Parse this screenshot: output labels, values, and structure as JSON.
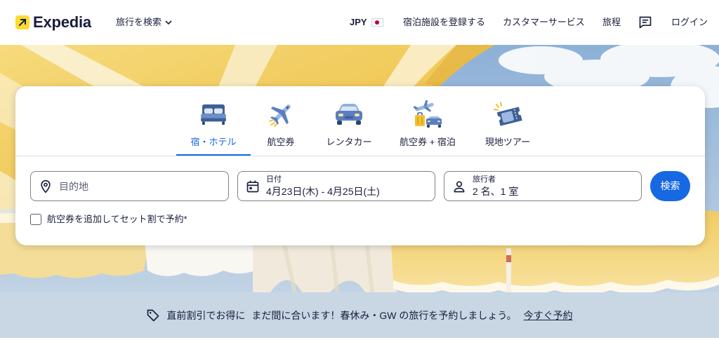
{
  "header": {
    "logo_text": "Expedia",
    "logo_icon": "expedia-arrow-icon",
    "search_menu_label": "旅行を検索",
    "currency": "JPY",
    "currency_flag": "japan-flag-icon",
    "list_property_label": "宿泊施設を登録する",
    "support_label": "カスタマーサービス",
    "trips_label": "旅程",
    "inbox_icon": "chat-icon",
    "login_label": "ログイン"
  },
  "search": {
    "tabs": [
      {
        "label": "宿・ホテル",
        "icon": "bed-icon",
        "active": true
      },
      {
        "label": "航空券",
        "icon": "plane-icon",
        "active": false
      },
      {
        "label": "レンタカー",
        "icon": "car-icon",
        "active": false
      },
      {
        "label": "航空券 + 宿泊",
        "icon": "plane-luggage-car-icon",
        "active": false
      },
      {
        "label": "現地ツアー",
        "icon": "ticket-icon",
        "active": false
      }
    ],
    "destination": {
      "placeholder": "目的地",
      "icon": "map-pin-icon"
    },
    "dates": {
      "label": "日付",
      "value": "4月23日(木) - 4月25日(土)",
      "icon": "calendar-icon"
    },
    "travelers": {
      "label": "旅行者",
      "value": "2 名、1 室",
      "icon": "person-icon"
    },
    "search_button_label": "検索",
    "add_flight": {
      "label": "航空券を追加してセット割で予約*",
      "checked": false
    }
  },
  "banner": {
    "icon": "tag-icon",
    "title": "直前割引でお得に",
    "message": "まだ間に合います！春休み・GW の旅行を予約しましょう。",
    "link_label": "今すぐ予約"
  },
  "colors": {
    "brand_yellow": "#fddb32",
    "accent_blue": "#1668e3",
    "text_navy": "#191e3b",
    "banner_background": "#c9d7e4"
  }
}
